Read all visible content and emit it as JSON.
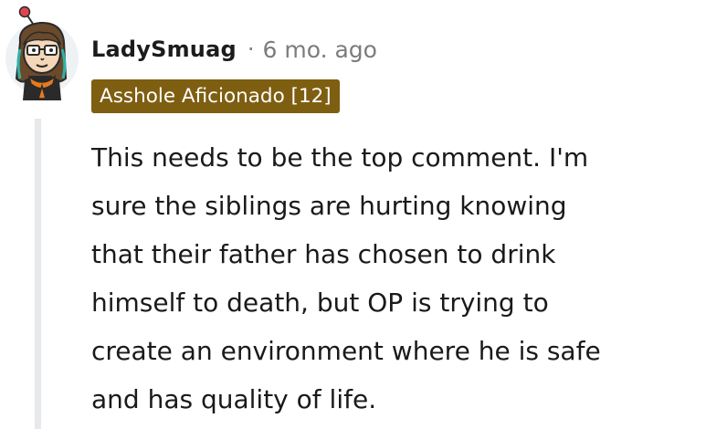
{
  "comment": {
    "author": "LadySmuag",
    "separator": "·",
    "timestamp": "6 mo. ago",
    "flair": {
      "label": "Asshole Aficionado [12]",
      "color": "#7e5e10"
    },
    "avatar_icon": "cartoon-character-avatar-icon",
    "body_lines": [
      "This needs to be the top comment. I'm",
      "sure the siblings are hurting knowing",
      "that their father has chosen to drink",
      "himself to death, but OP is trying to",
      "create an environment where he is safe",
      "and has quality of life."
    ]
  }
}
